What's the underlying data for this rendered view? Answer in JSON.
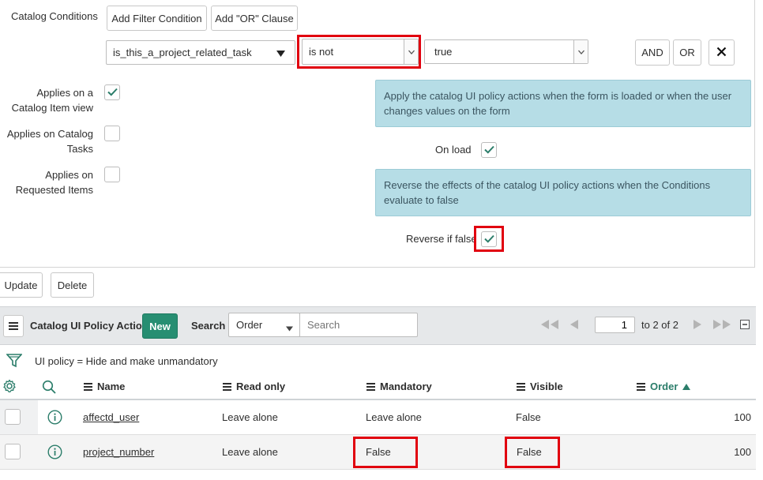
{
  "conditions": {
    "label": "Catalog Conditions",
    "add_filter_label": "Add Filter Condition",
    "add_or_label": "Add \"OR\" Clause",
    "field_value": "is_this_a_project_related_task",
    "operator_value": "is not",
    "value_value": "true",
    "and_label": "AND",
    "or_label": "OR"
  },
  "options": {
    "catalog_item_view_label": "Applies on a Catalog Item view",
    "catalog_tasks_label": "Applies on Catalog Tasks",
    "requested_items_label": "Applies on Requested Items",
    "info_onload": "Apply the catalog UI policy actions when the form is loaded or when the user changes values on the form",
    "on_load_label": "On load",
    "info_reverse": "Reverse the effects of the catalog UI policy actions when the Conditions evaluate to false",
    "reverse_label": "Reverse if false"
  },
  "form_buttons": {
    "update_label": "Update",
    "delete_label": "Delete"
  },
  "list": {
    "title": "Catalog UI Policy Actions",
    "new_label": "New",
    "search_label": "Search",
    "search_field": "Order",
    "search_placeholder": "Search",
    "page_value": "1",
    "page_range": "to 2 of 2",
    "filter_text": "UI policy = Hide and make unmandatory",
    "columns": [
      "Name",
      "Read only",
      "Mandatory",
      "Visible",
      "Order"
    ],
    "rows": [
      {
        "name": "affectd_user",
        "read_only": "Leave alone",
        "mandatory": "Leave alone",
        "visible": "False",
        "order": "100"
      },
      {
        "name": "project_number",
        "read_only": "Leave alone",
        "mandatory": "False",
        "visible": "False",
        "order": "100"
      }
    ]
  },
  "colors": {
    "highlight": "#e1000f",
    "info_bg": "#b6dde6",
    "new_button": "#278e72",
    "check": "#2b7d6a"
  },
  "icons": [
    "dropdown-caret-icon",
    "close-icon",
    "check-icon",
    "hamburger-icon",
    "first-page-icon",
    "prev-page-icon",
    "next-page-icon",
    "last-page-icon",
    "collapse-icon",
    "funnel-icon",
    "gear-icon",
    "search-icon",
    "info-icon",
    "sort-asc-icon"
  ]
}
